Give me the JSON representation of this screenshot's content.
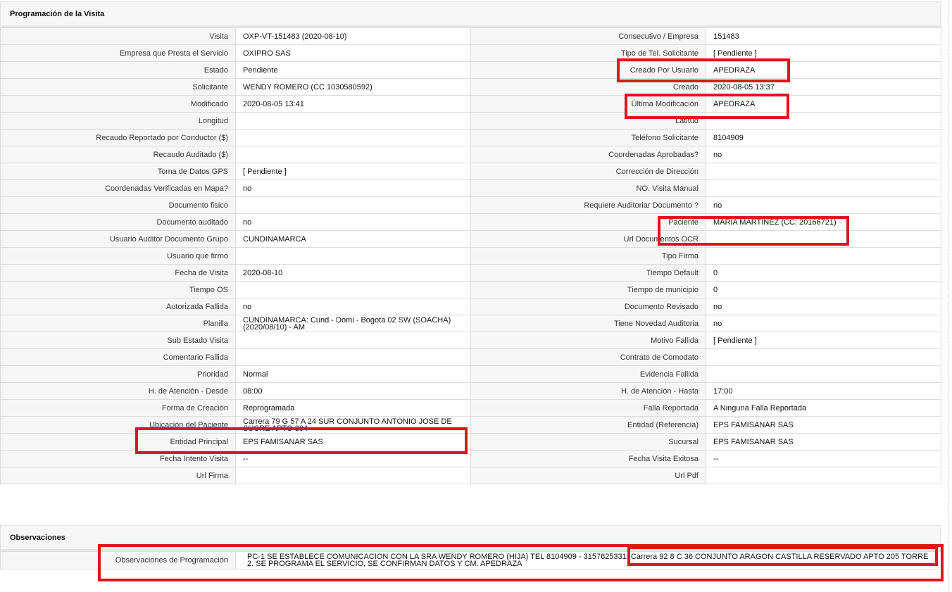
{
  "programacion": {
    "title": "Programación de la Visita",
    "rows": [
      [
        "Visita",
        "OXP-VT-151483 (2020-08-10)",
        "Consecutivo / Empresa",
        "151483"
      ],
      [
        "Empresa que Presta el Servicio",
        "OXIPRO SAS",
        "Tipo de Tel. Solicitante",
        "[ Pendiente ]"
      ],
      [
        "Estado",
        "Pendiente",
        "Creado Por Usuario",
        "APEDRAZA"
      ],
      [
        "Solicitante",
        "WENDY ROMERO (CC 1030580592)",
        "Creado",
        "2020-08-05 13:37"
      ],
      [
        "Modificado",
        "2020-08-05 13:41",
        "Última Modificación",
        " APEDRAZA"
      ],
      [
        "Longitud",
        "",
        "Latitud",
        ""
      ],
      [
        "Recaudo Reportado por Conductor ($)",
        "",
        "Teléfono Solicitante",
        "8104909"
      ],
      [
        "Recaudo Auditado ($)",
        "",
        "Coordenadas Aprobadas?",
        " no"
      ],
      [
        "Toma de Datos GPS",
        "[ Pendiente ]",
        "Corrección de Dirección",
        ""
      ],
      [
        "Coordenadas Verificadas en Mapa?",
        " no",
        "NO. Visita Manual",
        ""
      ],
      [
        "Documento fisico",
        "",
        "Requiere Auditoriar Documento ?",
        " no"
      ],
      [
        "Documento auditado",
        " no",
        "Paciente",
        "MARIA MARTINEZ (CC: 20166721)"
      ],
      [
        "Usuario Auditor Documento Grupo",
        "CUNDINAMARCA",
        "Url Documentos OCR",
        ""
      ],
      [
        "Usuario que firmo",
        "",
        "Tipo Firma",
        ""
      ],
      [
        "Fecha de Visita",
        " 2020-08-10",
        "Tiempo Default",
        "0"
      ],
      [
        "Tiempo OS",
        "",
        "Tiempo de municipio",
        "0"
      ],
      [
        "Autorizada Fallida",
        " no",
        "Documento Revisado",
        " no"
      ],
      [
        "Planilla",
        "CUNDINAMARCA: Cund - Domi - Bogota 02 SW (SOACHA) (2020/08/10) - AM",
        "Tiene Novedad Auditoria",
        " no"
      ],
      [
        "Sub Estado Visita",
        "",
        "Motivo Fallida",
        "[ Pendiente ]"
      ],
      [
        "Comentario Fallida",
        "",
        "Contrato de Comodato",
        ""
      ],
      [
        "Prioridad",
        "Normal",
        "Evidencia Fallida",
        ""
      ],
      [
        "H. de Atención - Desde",
        "08:00",
        "H. de Atención - Hasta",
        "17:00"
      ],
      [
        "Forma de Creación",
        "Reprogramada",
        "Falla Reportada",
        "A Ninguna Falla Reportada"
      ],
      [
        "Ubicación del Paciente",
        "Carrera 79 G 57 A 24 SUR CONJUNTO ANTONIO JOSE DE SUCRE APTO 304",
        "Entidad (Referencia)",
        "EPS FAMISANAR SAS"
      ],
      [
        "Entidad Principal",
        "EPS FAMISANAR SAS",
        "Sucursal",
        "EPS FAMISANAR SAS"
      ],
      [
        "Fecha Intento Visita",
        " --",
        "Fecha Visita Exitosa",
        " --"
      ],
      [
        "Url Firma",
        "",
        "Url Pdf",
        ""
      ]
    ]
  },
  "observaciones": {
    "title": "Observaciones",
    "label": "Observaciones de Programación",
    "value": "PC-1 SE ESTABLECE COMUNICACION CON LA SRA WENDY ROMERO (HIJA) TEL 8104909 - 3157625331. Carrera 92 8 C 36 CONJUNTO ARAGON CASTILLA RESERVADO APTO 205 TORRE 2. SE PROGRAMA EL SERVICIO, SE CONFIRMAN DATOS Y CM. APEDRAZA"
  },
  "colors": {
    "highlight": "#e0141c",
    "label_bg": "#f6f6f6",
    "border": "#dcdcdc"
  }
}
